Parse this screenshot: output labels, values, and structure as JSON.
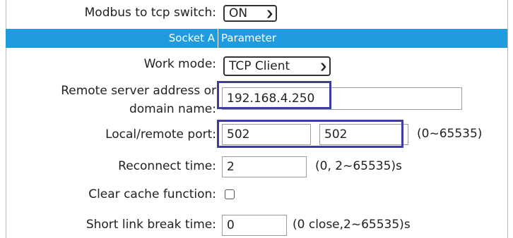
{
  "modbus": {
    "label": "Modbus to tcp switch:",
    "value": "ON"
  },
  "section": {
    "left": "Socket A",
    "right": "Parameter"
  },
  "work_mode": {
    "label": "Work mode:",
    "value": "TCP Client"
  },
  "remote_server": {
    "label_line1": "Remote server address or",
    "label_line2": "domain name:",
    "value": "192.168.4.250"
  },
  "ports": {
    "label": "Local/remote port:",
    "local": "502",
    "remote": "502",
    "hint": "(0~65535)"
  },
  "reconnect": {
    "label": "Reconnect time:",
    "value": "2",
    "hint": "(0, 2~65535)s"
  },
  "clear_cache": {
    "label": "Clear cache function:",
    "checked": false
  },
  "short_link": {
    "label": "Short link break time:",
    "value": "0",
    "hint": "(0 close,2~65535)s"
  },
  "colors": {
    "section_bar": "#1f9be0",
    "highlight": "#3d3d9e"
  }
}
